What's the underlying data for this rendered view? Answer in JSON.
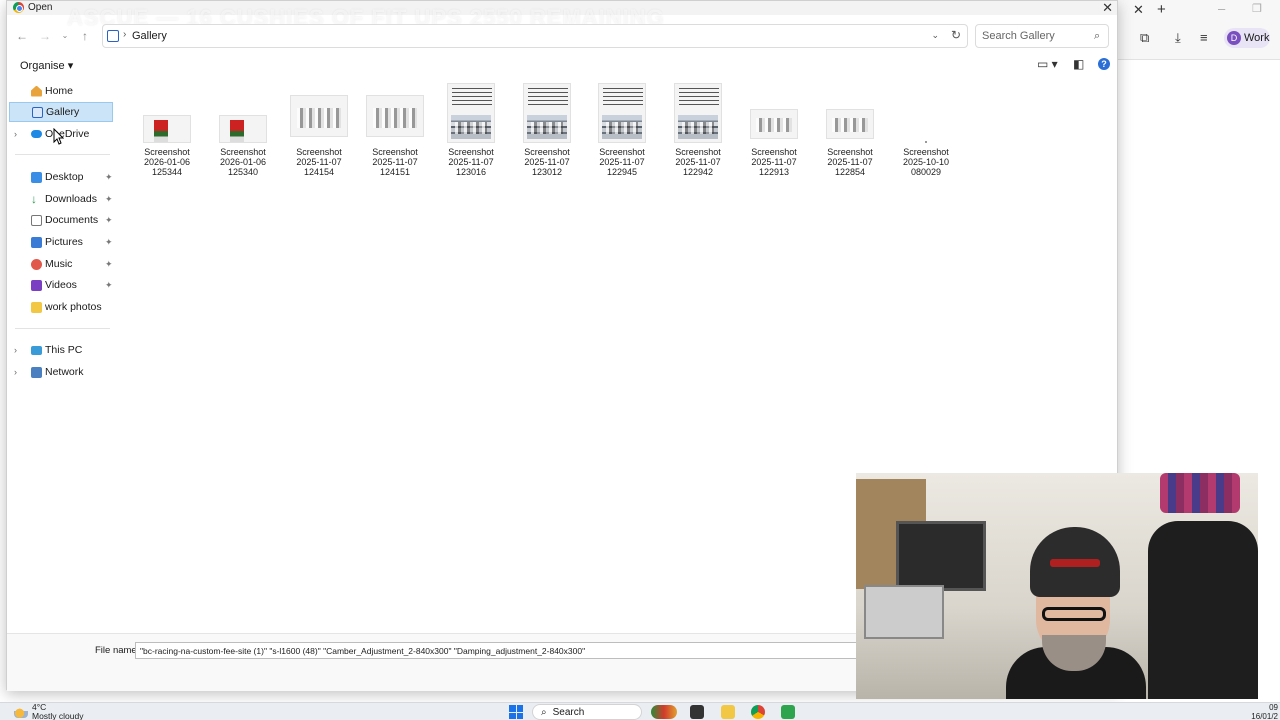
{
  "dialog": {
    "title": "Open",
    "overlay_banner": "ASCUE — 16 CUSHIES OF FIT UPS 2550 REMAINING"
  },
  "address": {
    "crumb": "Gallery",
    "search_placeholder": "Search Gallery"
  },
  "toolbar": {
    "organise_label": "Organise"
  },
  "sidebar": {
    "items": [
      {
        "label": "Home"
      },
      {
        "label": "Gallery"
      },
      {
        "label": "OneDrive"
      },
      {
        "label": "Desktop"
      },
      {
        "label": "Downloads"
      },
      {
        "label": "Documents"
      },
      {
        "label": "Pictures"
      },
      {
        "label": "Music"
      },
      {
        "label": "Videos"
      },
      {
        "label": "work photos"
      },
      {
        "label": "This PC"
      },
      {
        "label": "Network"
      }
    ]
  },
  "files": [
    {
      "l1": "Screenshot",
      "l2": "2026-01-06",
      "l3": "125344",
      "kind": "red"
    },
    {
      "l1": "Screenshot",
      "l2": "2026-01-06",
      "l3": "125340",
      "kind": "red"
    },
    {
      "l1": "Screenshot",
      "l2": "2025-11-07",
      "l3": "124154",
      "kind": "cars"
    },
    {
      "l1": "Screenshot",
      "l2": "2025-11-07",
      "l3": "124151",
      "kind": "cars"
    },
    {
      "l1": "Screenshot",
      "l2": "2025-11-07",
      "l3": "123016",
      "kind": "doc"
    },
    {
      "l1": "Screenshot",
      "l2": "2025-11-07",
      "l3": "123012",
      "kind": "doc"
    },
    {
      "l1": "Screenshot",
      "l2": "2025-11-07",
      "l3": "122945",
      "kind": "doccars"
    },
    {
      "l1": "Screenshot",
      "l2": "2025-11-07",
      "l3": "122942",
      "kind": "doccars"
    },
    {
      "l1": "Screenshot",
      "l2": "2025-11-07",
      "l3": "122913",
      "kind": "carsSmall"
    },
    {
      "l1": "Screenshot",
      "l2": "2025-11-07",
      "l3": "122854",
      "kind": "carsSmall"
    },
    {
      "l1": "Screenshot",
      "l2": "2025-10-10",
      "l3": "080029",
      "kind": "blank"
    }
  ],
  "filename": {
    "label": "File name:",
    "value": "\"bc-racing-na-custom-fee-site (1)\" \"s-l1600 (48)\" \"Camber_Adjustment_2-840x300\" \"Damping_adjustment_2-840x300\""
  },
  "browser": {
    "profile_label": "Work",
    "profile_initial": "D"
  },
  "taskbar": {
    "temperature": "4°C",
    "weather": "Mostly cloudy",
    "search_label": "Search",
    "time": "09",
    "date": "16/01/2"
  },
  "colors": {
    "accent": "#2b6fd6",
    "selection": "#cce4f7"
  }
}
